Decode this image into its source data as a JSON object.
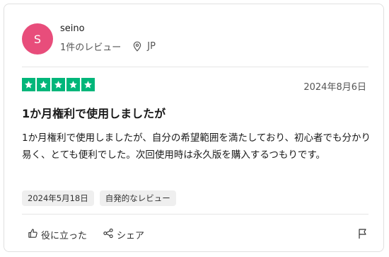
{
  "review": {
    "avatar_letter": "S",
    "user_name": "seino",
    "review_count": "1件のレビュー",
    "country": "JP",
    "rating": 5,
    "date": "2024年8月6日",
    "title": "1か月権利で使用しましたが",
    "body": "1か月権利で使用しましたが、自分の希望範囲を満たしており、初心者でも分かり易く、とても便利でした。次回使用時は永久版を購入するつもりです。",
    "tags": [
      "2024年5月18日",
      "自発的なレビュー"
    ],
    "actions": {
      "helpful_label": "役に立った",
      "share_label": "シェア"
    }
  },
  "colors": {
    "avatar_bg": "#e84d7b",
    "star_green": "#00b67a"
  },
  "icons": [
    "location-pin-icon",
    "star-icon",
    "thumbs-up-icon",
    "share-icon",
    "flag-icon"
  ]
}
